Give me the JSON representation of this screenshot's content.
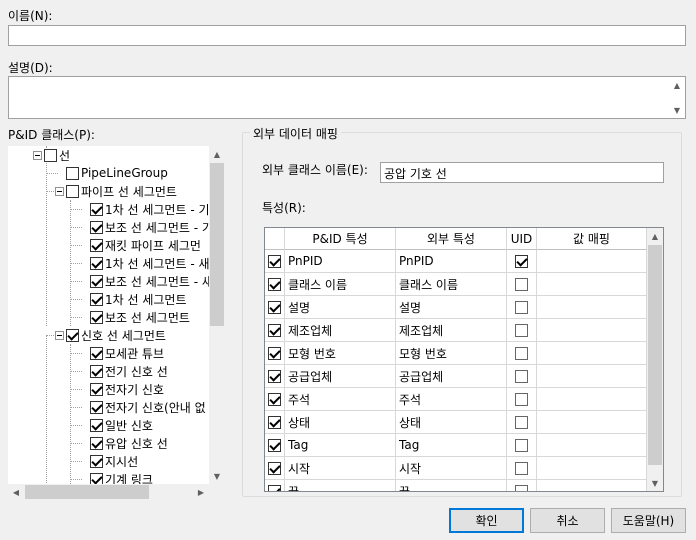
{
  "name_label": "이름(N):",
  "name_value": "",
  "desc_label": "설명(D):",
  "desc_value": "",
  "class_label": "P&ID 클래스(P):",
  "tree": [
    {
      "label": "선",
      "checked": false,
      "level": 0,
      "expander": true
    },
    {
      "label": "PipeLineGroup",
      "checked": false,
      "level": 1,
      "expander": false
    },
    {
      "label": "파이프 선 세그먼트",
      "checked": false,
      "level": 1,
      "expander": true
    },
    {
      "label": "1차 선 세그먼트 - 기",
      "checked": true,
      "level": 2,
      "expander": false
    },
    {
      "label": "보조 선 세그먼트 - 기",
      "checked": true,
      "level": 2,
      "expander": false
    },
    {
      "label": "재킷 파이프 세그먼",
      "checked": true,
      "level": 2,
      "expander": false
    },
    {
      "label": "1차 선 세그먼트 - 새",
      "checked": true,
      "level": 2,
      "expander": false
    },
    {
      "label": "보조 선 세그먼트 - 새",
      "checked": true,
      "level": 2,
      "expander": false
    },
    {
      "label": "1차 선 세그먼트",
      "checked": true,
      "level": 2,
      "expander": false
    },
    {
      "label": "보조 선 세그먼트",
      "checked": true,
      "level": 2,
      "expander": false
    },
    {
      "label": "신호 선 세그먼트",
      "checked": true,
      "level": 1,
      "expander": true
    },
    {
      "label": "모세관 튜브",
      "checked": true,
      "level": 2,
      "expander": false
    },
    {
      "label": "전기 신호 선",
      "checked": true,
      "level": 2,
      "expander": false
    },
    {
      "label": "전자기 신호",
      "checked": true,
      "level": 2,
      "expander": false
    },
    {
      "label": "전자기 신호(안내 없",
      "checked": true,
      "level": 2,
      "expander": false
    },
    {
      "label": "일반 신호",
      "checked": true,
      "level": 2,
      "expander": false
    },
    {
      "label": "유압 신호 선",
      "checked": true,
      "level": 2,
      "expander": false
    },
    {
      "label": "지시선",
      "checked": true,
      "level": 2,
      "expander": false
    },
    {
      "label": "기계 링크",
      "checked": true,
      "level": 2,
      "expander": false
    }
  ],
  "external_mapping_title": "외부 데이터 매핑",
  "ext_class_label": "외부 클래스 이름(E):",
  "ext_class_value": "공압 기호 선",
  "properties_label": "특성(R):",
  "grid_headers": [
    "P&ID 특성",
    "외부 특성",
    "UID",
    "값 매핑"
  ],
  "grid_rows": [
    {
      "checked": true,
      "pid": "PnPID",
      "ext": "PnPID",
      "uid": true
    },
    {
      "checked": true,
      "pid": "클래스 이름",
      "ext": "클래스 이름",
      "uid": false
    },
    {
      "checked": true,
      "pid": "설명",
      "ext": "설명",
      "uid": false
    },
    {
      "checked": true,
      "pid": "제조업체",
      "ext": "제조업체",
      "uid": false
    },
    {
      "checked": true,
      "pid": "모형 번호",
      "ext": "모형 번호",
      "uid": false
    },
    {
      "checked": true,
      "pid": "공급업체",
      "ext": "공급업체",
      "uid": false
    },
    {
      "checked": true,
      "pid": "주석",
      "ext": "주석",
      "uid": false
    },
    {
      "checked": true,
      "pid": "상태",
      "ext": "상태",
      "uid": false
    },
    {
      "checked": true,
      "pid": "Tag",
      "ext": "Tag",
      "uid": false
    },
    {
      "checked": true,
      "pid": "시작",
      "ext": "시작",
      "uid": false
    },
    {
      "checked": true,
      "pid": "끝",
      "ext": "끝",
      "uid": false
    }
  ],
  "buttons": {
    "ok": "확인",
    "cancel": "취소",
    "help": "도움말(H)"
  },
  "colors": {
    "default_button_border": "#0078d7",
    "dialog_bg": "#f0f0f0"
  }
}
